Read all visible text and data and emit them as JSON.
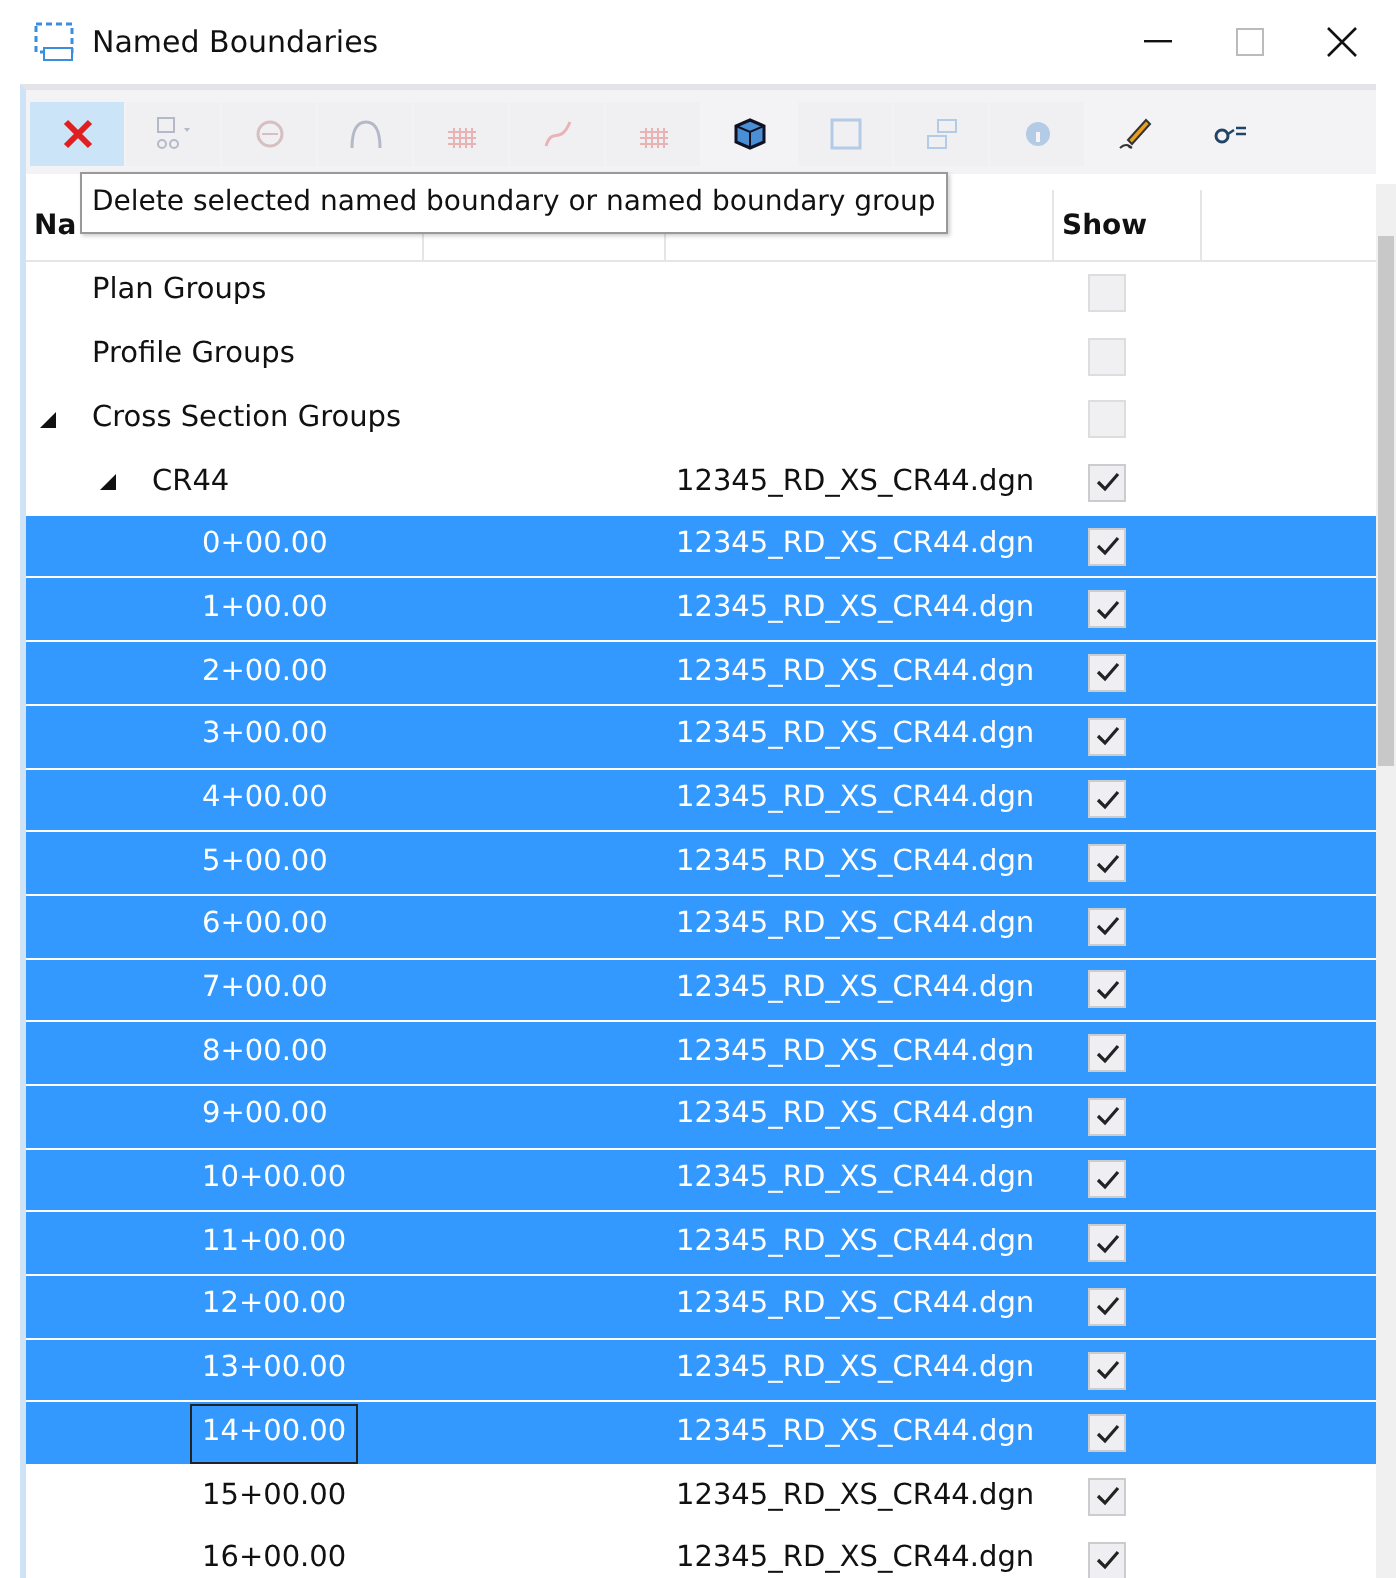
{
  "window": {
    "title": "Named Boundaries"
  },
  "toolbar": [
    {
      "kind": "delete",
      "disabled": false,
      "highlighted": true
    },
    {
      "kind": "add-dropdown",
      "disabled": true,
      "highlighted": false
    },
    {
      "kind": "shape",
      "disabled": true,
      "highlighted": false
    },
    {
      "kind": "arc",
      "disabled": true,
      "highlighted": false
    },
    {
      "kind": "grid",
      "disabled": true,
      "highlighted": false
    },
    {
      "kind": "curve",
      "disabled": true,
      "highlighted": false
    },
    {
      "kind": "grid",
      "disabled": true,
      "highlighted": false
    },
    {
      "kind": "cube",
      "disabled": false,
      "highlighted": false
    },
    {
      "kind": "frame",
      "disabled": true,
      "highlighted": false
    },
    {
      "kind": "move",
      "disabled": true,
      "highlighted": false
    },
    {
      "kind": "info",
      "disabled": true,
      "highlighted": false
    },
    {
      "kind": "pencil",
      "disabled": false,
      "highlighted": false
    },
    {
      "kind": "key",
      "disabled": false,
      "highlighted": false
    }
  ],
  "tooltip": "Delete selected named boundary or named boundary group",
  "table": {
    "columns": [
      "Na",
      "",
      "",
      "Show"
    ],
    "rows": [
      {
        "name": "Plan Groups",
        "file": "",
        "show": false,
        "enabled": false,
        "selected": false,
        "focused": false
      },
      {
        "name": "Profile Groups",
        "file": "",
        "show": false,
        "enabled": false,
        "selected": false,
        "focused": false
      },
      {
        "name": "Cross Section Groups",
        "file": "",
        "show": false,
        "enabled": false,
        "selected": false,
        "focused": false,
        "expanded": true,
        "children": [
          {
            "name": "CR44",
            "file": "12345_RD_XS_CR44.dgn",
            "show": true,
            "enabled": true,
            "selected": false,
            "focused": false,
            "expanded": true,
            "children": [
              {
                "name": "0+00.00",
                "file": "12345_RD_XS_CR44.dgn",
                "show": true,
                "enabled": true,
                "selected": true,
                "focused": false
              },
              {
                "name": "1+00.00",
                "file": "12345_RD_XS_CR44.dgn",
                "show": true,
                "enabled": true,
                "selected": true,
                "focused": false
              },
              {
                "name": "2+00.00",
                "file": "12345_RD_XS_CR44.dgn",
                "show": true,
                "enabled": true,
                "selected": true,
                "focused": false
              },
              {
                "name": "3+00.00",
                "file": "12345_RD_XS_CR44.dgn",
                "show": true,
                "enabled": true,
                "selected": true,
                "focused": false
              },
              {
                "name": "4+00.00",
                "file": "12345_RD_XS_CR44.dgn",
                "show": true,
                "enabled": true,
                "selected": true,
                "focused": false
              },
              {
                "name": "5+00.00",
                "file": "12345_RD_XS_CR44.dgn",
                "show": true,
                "enabled": true,
                "selected": true,
                "focused": false
              },
              {
                "name": "6+00.00",
                "file": "12345_RD_XS_CR44.dgn",
                "show": true,
                "enabled": true,
                "selected": true,
                "focused": false
              },
              {
                "name": "7+00.00",
                "file": "12345_RD_XS_CR44.dgn",
                "show": true,
                "enabled": true,
                "selected": true,
                "focused": false
              },
              {
                "name": "8+00.00",
                "file": "12345_RD_XS_CR44.dgn",
                "show": true,
                "enabled": true,
                "selected": true,
                "focused": false
              },
              {
                "name": "9+00.00",
                "file": "12345_RD_XS_CR44.dgn",
                "show": true,
                "enabled": true,
                "selected": true,
                "focused": false
              },
              {
                "name": "10+00.00",
                "file": "12345_RD_XS_CR44.dgn",
                "show": true,
                "enabled": true,
                "selected": true,
                "focused": false
              },
              {
                "name": "11+00.00",
                "file": "12345_RD_XS_CR44.dgn",
                "show": true,
                "enabled": true,
                "selected": true,
                "focused": false
              },
              {
                "name": "12+00.00",
                "file": "12345_RD_XS_CR44.dgn",
                "show": true,
                "enabled": true,
                "selected": true,
                "focused": false
              },
              {
                "name": "13+00.00",
                "file": "12345_RD_XS_CR44.dgn",
                "show": true,
                "enabled": true,
                "selected": true,
                "focused": false
              },
              {
                "name": "14+00.00",
                "file": "12345_RD_XS_CR44.dgn",
                "show": true,
                "enabled": true,
                "selected": true,
                "focused": true
              },
              {
                "name": "15+00.00",
                "file": "12345_RD_XS_CR44.dgn",
                "show": true,
                "enabled": true,
                "selected": false,
                "focused": false
              },
              {
                "name": "16+00.00",
                "file": "12345_RD_XS_CR44.dgn",
                "show": true,
                "enabled": true,
                "selected": false,
                "focused": false
              }
            ]
          }
        ]
      }
    ]
  }
}
